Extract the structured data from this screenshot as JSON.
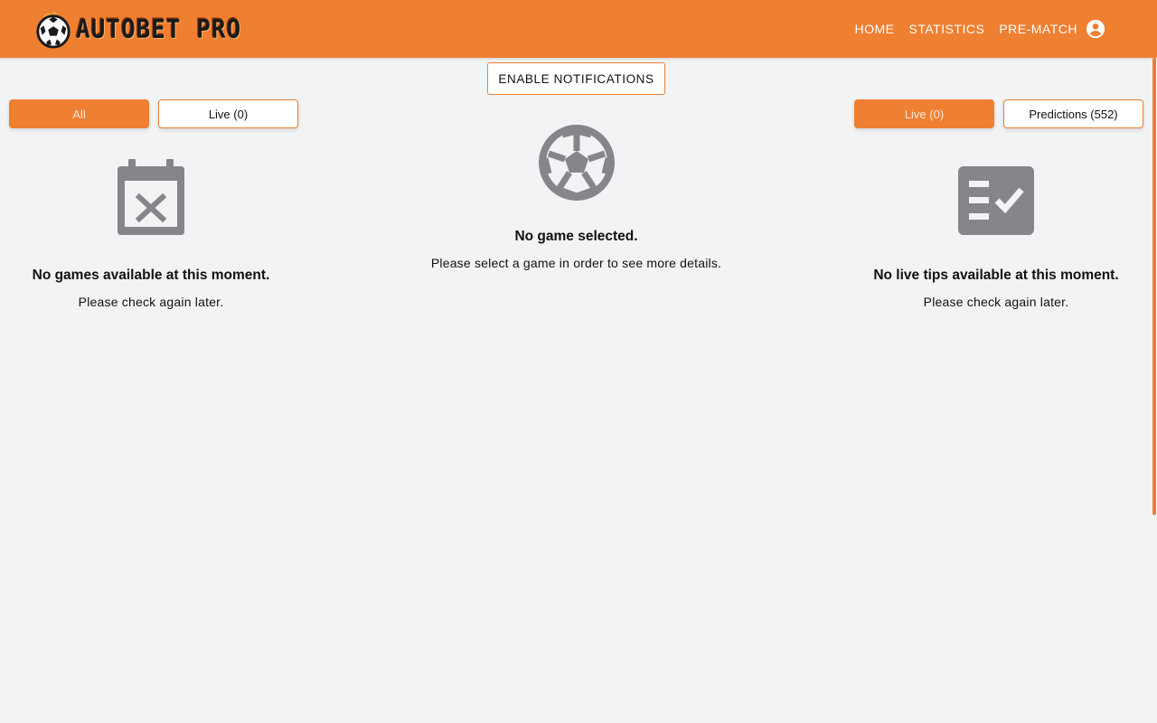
{
  "header": {
    "brand": "AUTOBET PRO",
    "nav": [
      {
        "label": "HOME"
      },
      {
        "label": "STATISTICS"
      },
      {
        "label": "PRE-MATCH"
      }
    ],
    "user_icon": "account-circle-icon"
  },
  "actions": {
    "enable_notifications": "ENABLE NOTIFICATIONS"
  },
  "left_panel": {
    "tabs": [
      {
        "label": "All",
        "active": true
      },
      {
        "label": "Live (0)",
        "active": false
      }
    ],
    "icon": "calendar-remove-icon",
    "title": "No games available at this moment.",
    "subtitle": "Please check again later."
  },
  "center_panel": {
    "icon": "soccer-ball-icon",
    "title": "No game selected.",
    "subtitle": "Please select a game in order to see more details."
  },
  "right_panel": {
    "tabs": [
      {
        "label": "Live (0)",
        "active": true
      },
      {
        "label": "Predictions (552)",
        "active": false
      }
    ],
    "icon": "checklist-icon",
    "title": "No live tips available at this moment.",
    "subtitle": "Please check again later."
  },
  "colors": {
    "accent": "#ef7f31",
    "background": "#f1f3f5",
    "icon_gray": "#85868a"
  }
}
